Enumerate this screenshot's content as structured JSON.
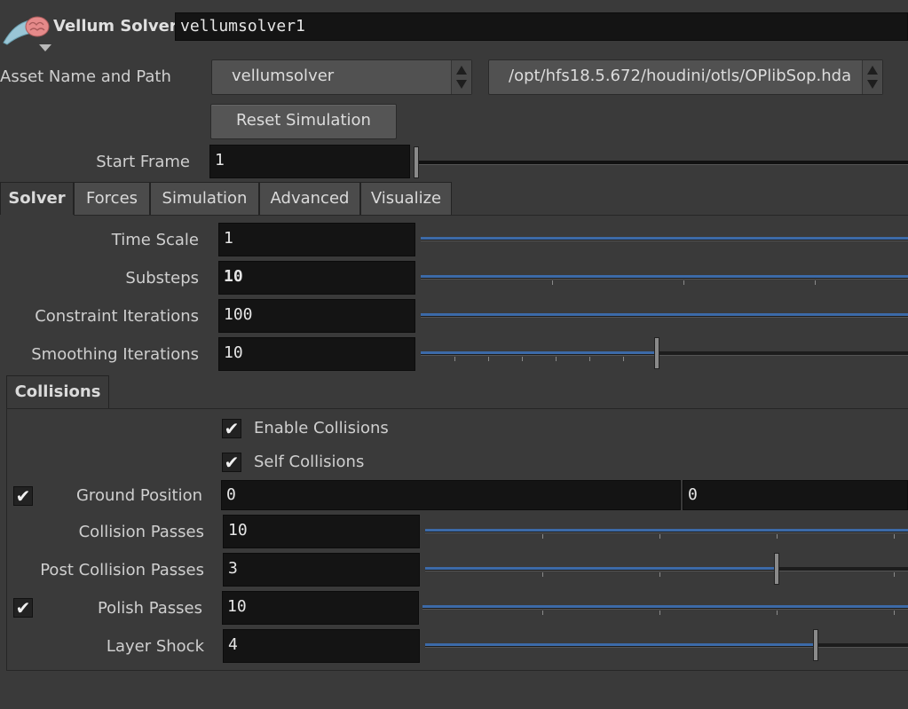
{
  "header": {
    "node_type": "Vellum Solver",
    "node_name": "vellumsolver1",
    "icon": "brain-cloth-icon"
  },
  "asset": {
    "label": "Asset Name and Path",
    "name": "vellumsolver",
    "path": "/opt/hfs18.5.672/houdini/otls/OPlibSop.hda"
  },
  "reset_button": "Reset Simulation",
  "start_frame": {
    "label": "Start Frame",
    "value": "1",
    "slider_fraction": 0.0
  },
  "tabs": [
    {
      "label": "Solver",
      "active": true
    },
    {
      "label": "Forces",
      "active": false
    },
    {
      "label": "Simulation",
      "active": false
    },
    {
      "label": "Advanced",
      "active": false
    },
    {
      "label": "Visualize",
      "active": false
    }
  ],
  "solver_params": [
    {
      "label": "Time Scale",
      "value": "1",
      "slider_fraction": 1.0
    },
    {
      "label": "Substeps",
      "value": "10",
      "slider_fraction": 1.0
    },
    {
      "label": "Constraint Iterations",
      "value": "100",
      "slider_fraction": 1.0
    },
    {
      "label": "Smoothing Iterations",
      "value": "10",
      "slider_fraction": 0.48
    }
  ],
  "collisions": {
    "tab_label": "Collisions",
    "enable_collisions": {
      "label": "Enable Collisions",
      "checked": true
    },
    "self_collisions": {
      "label": "Self Collisions",
      "checked": true
    },
    "ground_position": {
      "label": "Ground Position",
      "checked": true,
      "value1": "0",
      "value2": "0"
    },
    "collision_passes": {
      "label": "Collision Passes",
      "value": "10",
      "slider_fraction": 1.0
    },
    "post_collision_passes": {
      "label": "Post Collision Passes",
      "value": "3",
      "slider_fraction": 0.73
    },
    "polish_passes": {
      "label": "Polish Passes",
      "checked": true,
      "value": "10",
      "slider_fraction": 1.0
    },
    "layer_shock": {
      "label": "Layer Shock",
      "value": "4",
      "slider_fraction": 0.81
    }
  },
  "colors": {
    "background": "#3a3a3a",
    "field": "#141414",
    "slider_fill": "#3c6aa8"
  }
}
